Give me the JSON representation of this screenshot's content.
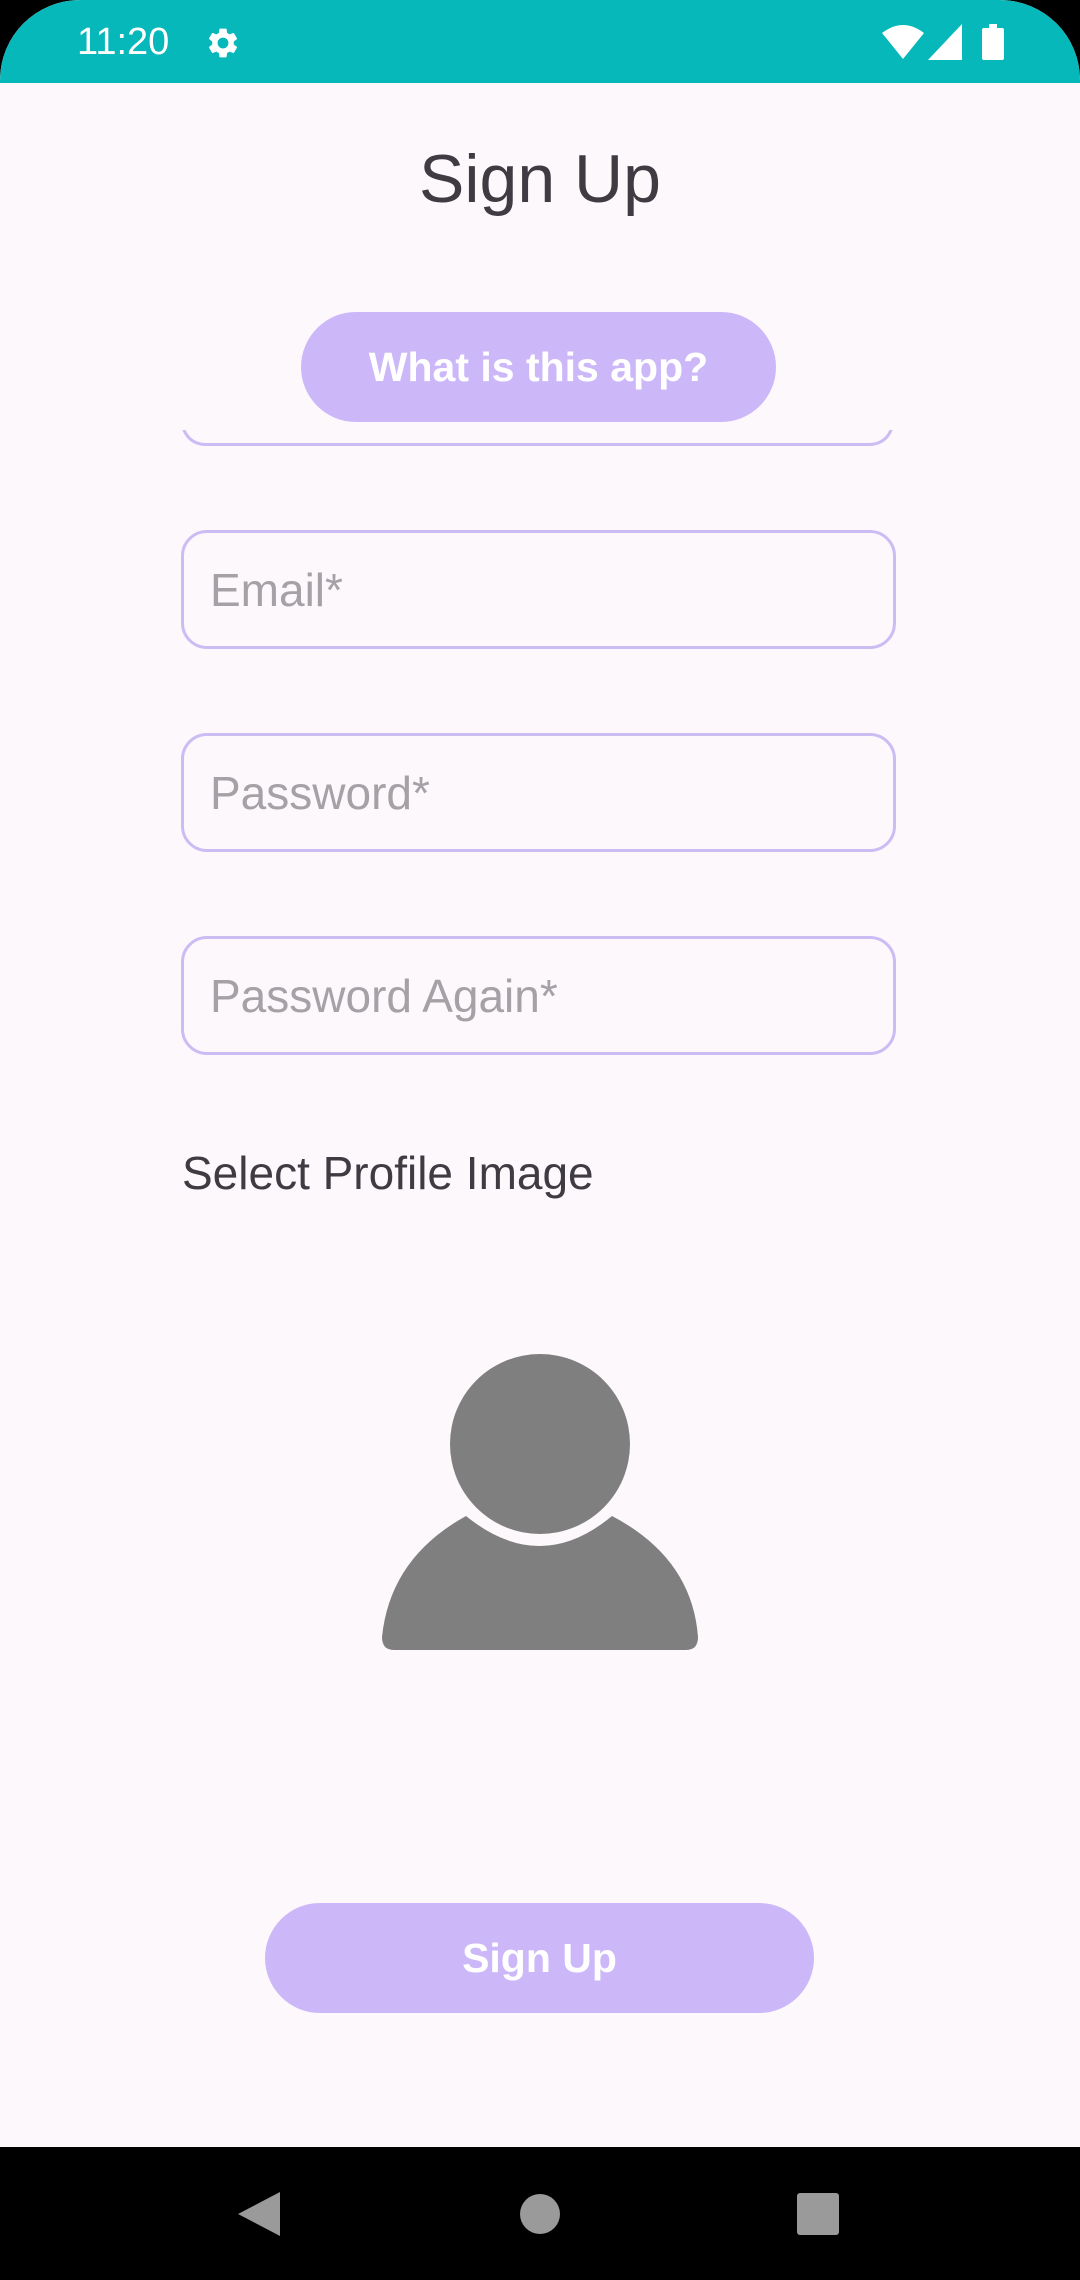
{
  "status_bar": {
    "time": "11:20",
    "icons": [
      "gear-icon",
      "wifi-icon",
      "cell-signal-icon",
      "battery-icon"
    ]
  },
  "header": {
    "title": "Sign Up"
  },
  "info_button": {
    "label": "What is this app?"
  },
  "form": {
    "email_placeholder": "Email*",
    "password_placeholder": "Password*",
    "password_again_placeholder": "Password Again*",
    "profile_image_label": "Select Profile Image"
  },
  "actions": {
    "signup_label": "Sign Up"
  },
  "navigation": {
    "icons": [
      "back-icon",
      "home-icon",
      "recents-icon"
    ]
  },
  "colors": {
    "status_bar": "#06B8B9",
    "background": "#FDF8FC",
    "button": "#CCB8F8",
    "field_border": "#CBBDF3",
    "avatar": "#7F7F7F"
  }
}
